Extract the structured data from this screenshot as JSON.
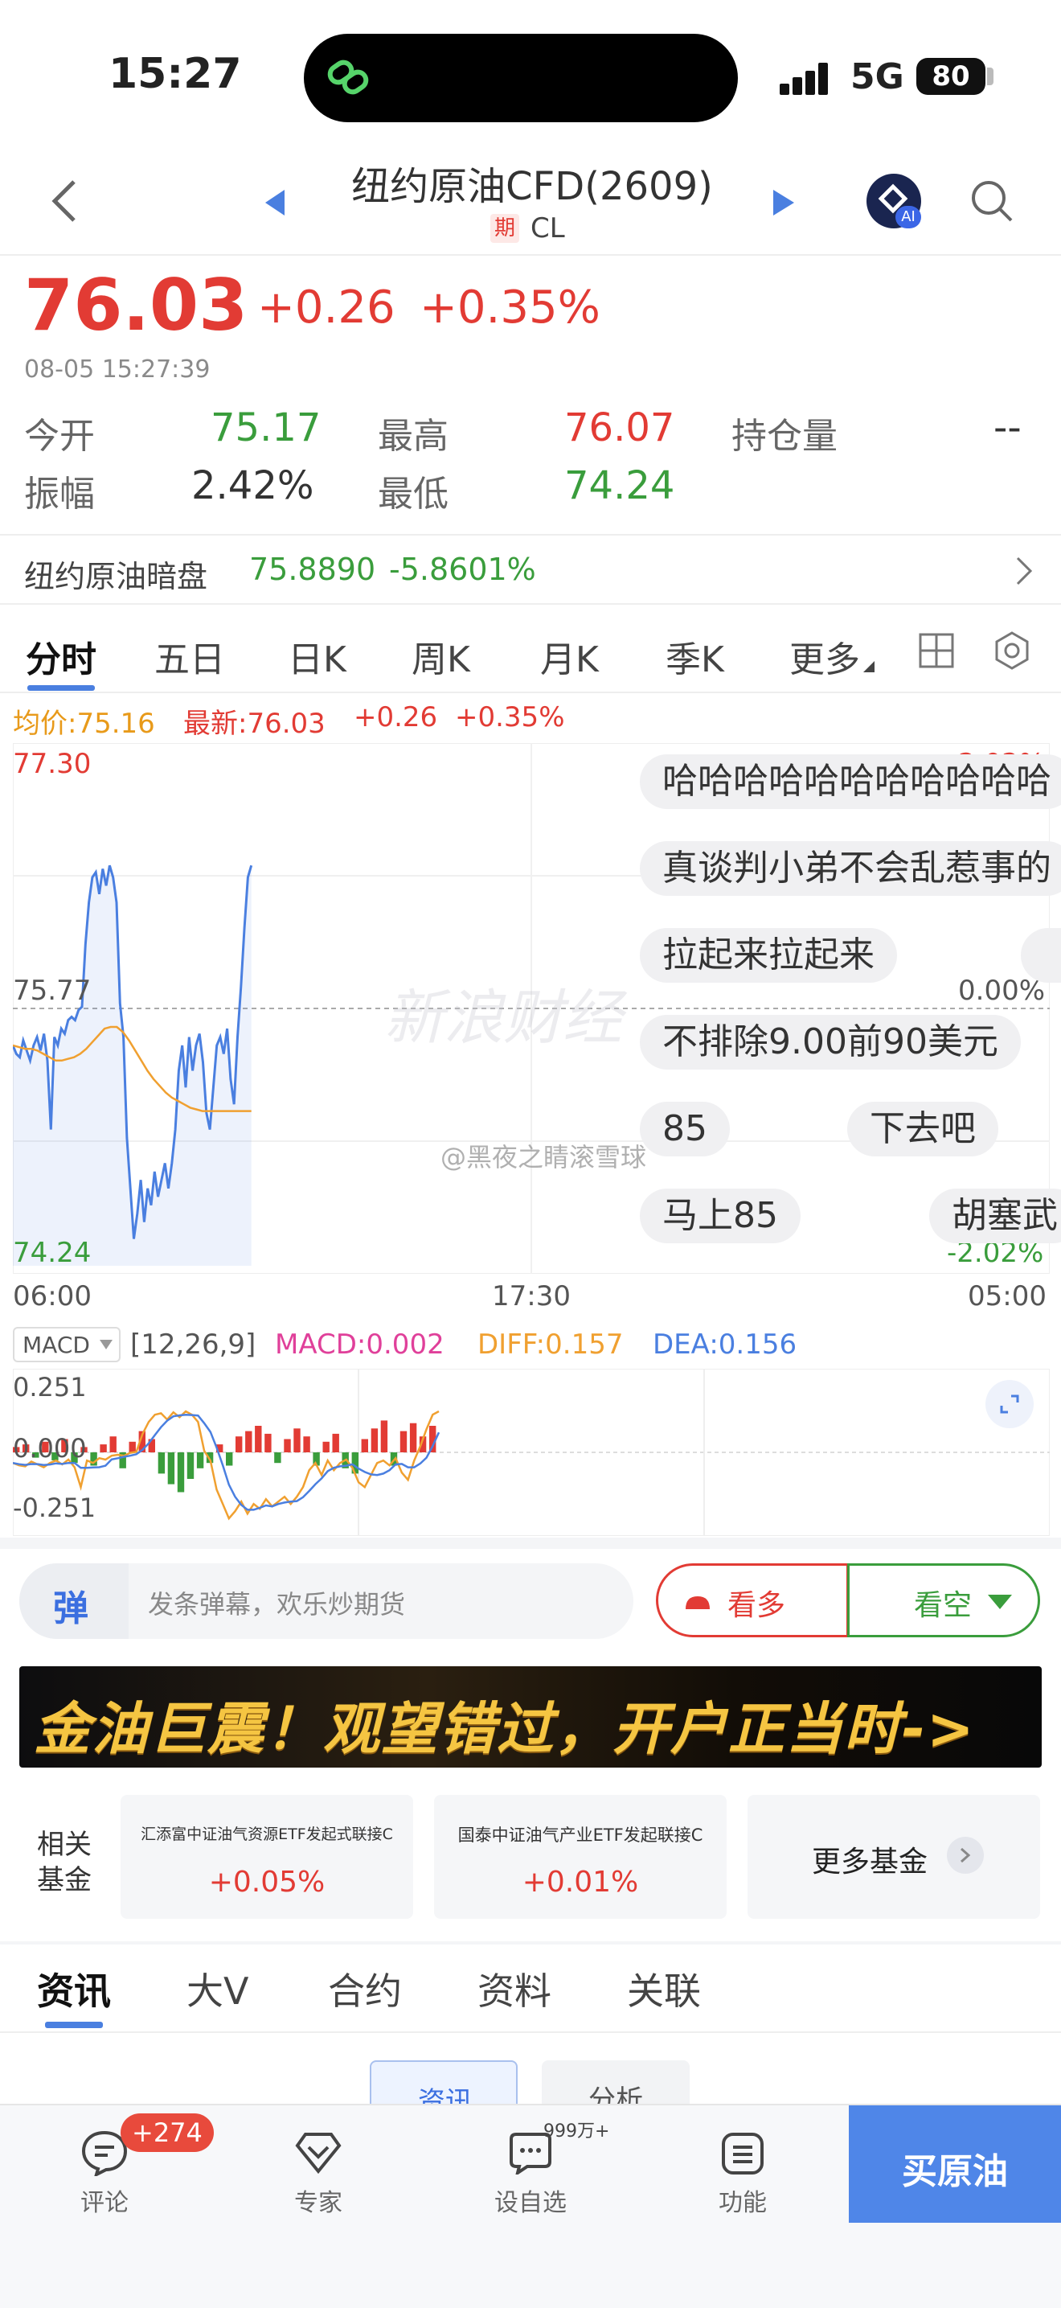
{
  "status_bar": {
    "time": "15:27",
    "network": "5G",
    "battery": "80"
  },
  "header": {
    "title": "纽约原油CFD(2609)",
    "futures_badge": "期",
    "symbol": "CL",
    "ai_badge": "AI"
  },
  "quote": {
    "price": "76.03",
    "change": "+0.26",
    "change_pct": "+0.35%",
    "timestamp": "08-05 15:27:39",
    "open_label": "今开",
    "open": "75.17",
    "high_label": "最高",
    "high": "76.07",
    "oi_label": "持仓量",
    "oi": "--",
    "amp_label": "振幅",
    "amp": "2.42%",
    "low_label": "最低",
    "low": "74.24"
  },
  "dark_pool": {
    "label": "纽约原油暗盘",
    "price": "75.8890",
    "change_pct": "-5.8601%"
  },
  "chart_tabs": [
    "分时",
    "五日",
    "日K",
    "周K",
    "月K",
    "季K",
    "更多"
  ],
  "chart_info": {
    "avg": "均价:75.16",
    "latest": "最新:76.03",
    "change": "+0.26",
    "change_pct": "+0.35%"
  },
  "chart_labels": {
    "y_high": "77.30",
    "y_mid": "75.77",
    "y_low": "74.24",
    "pct_high": "2.02%",
    "pct_mid": "0.00%",
    "pct_low": "-2.02%",
    "x_start": "06:00",
    "x_mid": "17:30",
    "x_end": "05:00",
    "watermark": "新浪财经",
    "weibo": "@黑夜之睛滚雪球"
  },
  "danmaku": [
    "哈哈哈哈哈哈哈哈哈哈哈",
    "真谈判小弟不会乱惹事的",
    "拉起来拉起来",
    "不排除9.00前90美元",
    "85",
    "下去吧",
    "马上85",
    "胡塞武"
  ],
  "macd": {
    "selector": "MACD",
    "params": "[12,26,9]",
    "macd": "MACD:0.002",
    "diff": "DIFF:0.157",
    "dea": "DEA:0.156",
    "y_top": "0.251",
    "y_mid": "0.000",
    "y_bot": "-0.251"
  },
  "comment_bar": {
    "icon": "弹",
    "placeholder": "发条弹幕，欢乐炒期货",
    "bull": "看多",
    "bear": "看空"
  },
  "banner": {
    "text": "金油巨震！观望错过，开户正当时->"
  },
  "funds": {
    "label_line1": "相关",
    "label_line2": "基金",
    "items": [
      {
        "name": "汇添富中证油气资源ETF发起式联接C",
        "change": "+0.05%"
      },
      {
        "name": "国泰中证油气产业ETF发起联接C",
        "change": "+0.01%"
      }
    ],
    "more": "更多基金"
  },
  "news_tabs": [
    "资讯",
    "大V",
    "合约",
    "资料",
    "关联"
  ],
  "sub_tabs": [
    "资讯",
    "分析"
  ],
  "bottom_nav": {
    "comment": "评论",
    "comment_badge": "+274",
    "expert": "专家",
    "watchlist": "设自选",
    "watchlist_count": "999万+",
    "function": "功能",
    "buy": "买原油"
  },
  "colors": {
    "up": "#e23b34",
    "down": "#3a9d3c",
    "accent": "#4a7fe0",
    "avg_line": "#f0a030",
    "price_line": "#4a7fe0"
  },
  "chart_data": {
    "type": "line",
    "x_range": [
      "06:00",
      "05:00"
    ],
    "ylim": [
      74.24,
      77.3
    ],
    "reference": 75.77,
    "series": [
      {
        "name": "最新",
        "values": [
          75.55,
          75.5,
          75.48,
          75.58,
          75.52,
          75.46,
          75.55,
          75.6,
          75.52,
          75.62,
          75.46,
          75.05,
          75.6,
          75.55,
          75.65,
          75.62,
          75.7,
          75.72,
          75.7,
          75.76,
          75.78,
          76.15,
          76.4,
          76.55,
          76.58,
          76.45,
          76.6,
          76.5,
          76.62,
          76.55,
          76.4,
          75.8,
          75.6,
          75.0,
          74.7,
          74.4,
          74.55,
          74.75,
          74.5,
          74.7,
          74.6,
          74.8,
          74.65,
          74.75,
          74.85,
          74.7,
          74.85,
          75.05,
          75.4,
          75.55,
          75.3,
          75.6,
          75.4,
          75.55,
          75.62,
          75.45,
          75.15,
          75.05,
          75.3,
          75.55,
          75.6,
          75.5,
          75.65,
          75.35,
          75.2,
          75.6,
          75.9,
          76.25,
          76.55,
          76.62
        ]
      },
      {
        "name": "均价",
        "values": [
          75.55,
          75.54,
          75.53,
          75.53,
          75.52,
          75.5,
          75.48,
          75.46,
          75.46,
          75.47,
          75.48,
          75.5,
          75.53,
          75.57,
          75.61,
          75.65,
          75.66,
          75.66,
          75.63,
          75.58,
          75.52,
          75.46,
          75.4,
          75.35,
          75.31,
          75.27,
          75.24,
          75.22,
          75.2,
          75.18,
          75.17,
          75.16,
          75.16,
          75.16,
          75.16,
          75.16,
          75.16,
          75.16,
          75.16,
          75.16
        ]
      }
    ],
    "macd_bars": [
      0.02,
      0.03,
      -0.02,
      0.04,
      -0.03,
      0.05,
      -0.04,
      0.02,
      -0.05,
      0.03,
      0.06,
      -0.06,
      0.04,
      0.08,
      0.05,
      -0.08,
      -0.12,
      -0.15,
      -0.1,
      -0.06,
      -0.04,
      0.03,
      -0.05,
      0.06,
      0.08,
      0.1,
      0.07,
      -0.04,
      0.05,
      0.09,
      0.06,
      -0.05,
      0.04,
      0.07,
      -0.06,
      -0.08,
      0.05,
      0.09,
      0.12,
      -0.05,
      0.08,
      0.11,
      0.06,
      0.1
    ]
  }
}
